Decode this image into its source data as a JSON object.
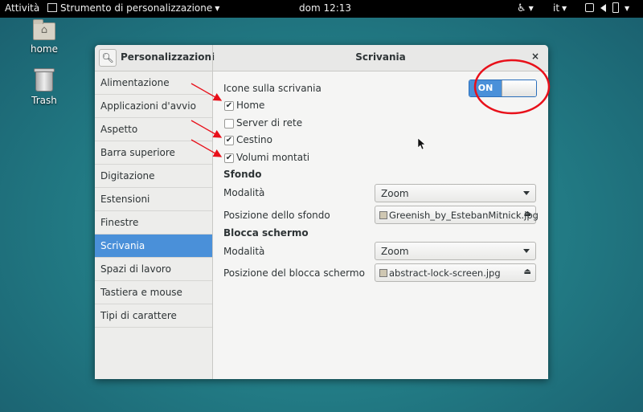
{
  "topbar": {
    "activities": "Attività",
    "app_menu": "Strumento di personalizzazione",
    "clock": "dom 12:13",
    "accessibility": "♿",
    "language": "it"
  },
  "desktop": {
    "icons": [
      {
        "label": "home"
      },
      {
        "label": "Trash"
      }
    ]
  },
  "window": {
    "left_title": "Personalizzazioni",
    "right_title": "Scrivania",
    "close": "×",
    "sidebar": [
      "Alimentazione",
      "Applicazioni d'avvio",
      "Aspetto",
      "Barra superiore",
      "Digitazione",
      "Estensioni",
      "Finestre",
      "Scrivania",
      "Spazi di lavoro",
      "Tastiera e mouse",
      "Tipi di carattere"
    ],
    "active_index": 7,
    "desktop_icons": {
      "label": "Icone sulla scrivania",
      "switch_label": "ON",
      "switch_on": true,
      "items": [
        {
          "label": "Home",
          "checked": true
        },
        {
          "label": "Server di rete",
          "checked": false
        },
        {
          "label": "Cestino",
          "checked": true
        },
        {
          "label": "Volumi montati",
          "checked": true
        }
      ]
    },
    "background": {
      "header": "Sfondo",
      "mode_label": "Modalità",
      "mode_value": "Zoom",
      "position_label": "Posizione dello sfondo",
      "file": "Greenish_by_EstebanMitnick.jpg"
    },
    "lock_screen": {
      "header": "Blocca schermo",
      "mode_label": "Modalità",
      "mode_value": "Zoom",
      "position_label": "Posizione del blocca schermo",
      "file": "abstract-lock-screen.jpg"
    }
  },
  "colors": {
    "accent": "#4a90d9",
    "annotation": "#e8101a"
  }
}
